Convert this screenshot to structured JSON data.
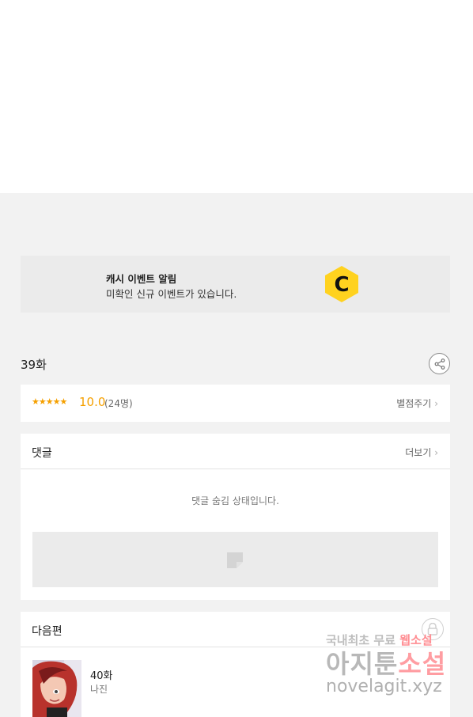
{
  "banner": {
    "title": "캐시 이벤트 알림",
    "subtitle": "미확인 신규 이벤트가 있습니다.",
    "logo_letter": "C",
    "logo_color": "#ffd21f"
  },
  "episode": {
    "title": "39화"
  },
  "rating": {
    "stars": "★★★★★",
    "score": "10.0",
    "count": "(24명)",
    "action": "별점주기",
    "accent_color": "#f5a000"
  },
  "comments": {
    "title": "댓글",
    "more": "더보기",
    "hidden_message": "댓글 숨김 상태입니다."
  },
  "next": {
    "title": "다음편",
    "episode": "40화",
    "subtitle": "나진"
  },
  "watermark": {
    "line1_a": "국내최초 무료 ",
    "line1_b": "웹소설",
    "line2_a": "아지툰",
    "line2_b": "소설",
    "line3": "novelagit.xyz"
  }
}
